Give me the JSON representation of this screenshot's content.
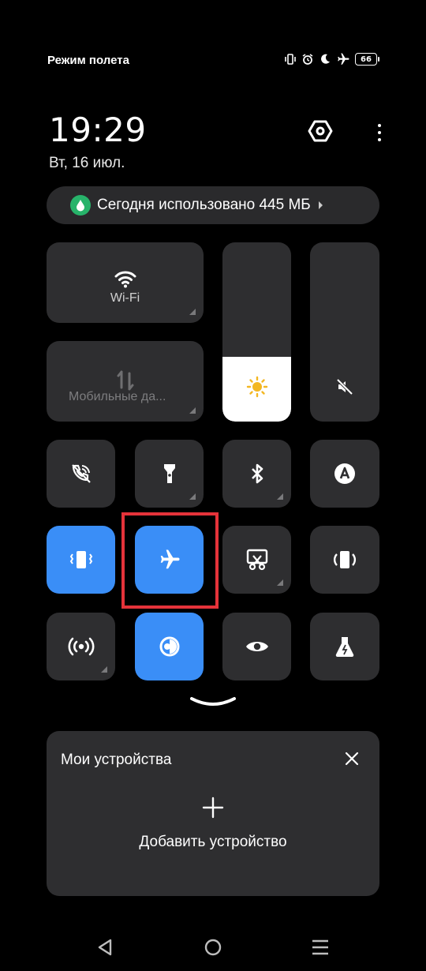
{
  "status_bar": {
    "title": "Режим полета",
    "battery": "66",
    "icons": [
      "vibrate-icon",
      "alarm-icon",
      "moon-icon",
      "airplane-icon",
      "battery-icon"
    ]
  },
  "header": {
    "time": "19:29",
    "date": "Вт, 16 июл.",
    "settings_icon": "hexagon-settings-icon",
    "more_icon": "more-vertical-icon"
  },
  "data_usage": {
    "text": "Сегодня использовано 445 МБ",
    "accent": "#27b36a"
  },
  "big_tiles": {
    "wifi": {
      "label": "Wi-Fi",
      "icon": "wifi-icon",
      "state": "on"
    },
    "mobile_data": {
      "label": "Мобильные да...",
      "icon": "mobile-data-icon",
      "state": "off"
    }
  },
  "sliders": {
    "brightness": {
      "icon": "sun-icon",
      "level": 0.36
    },
    "volume": {
      "icon": "mute-icon",
      "level": 0
    }
  },
  "tiles_row1": [
    {
      "name": "wifi-calling",
      "icon": "wifi-calling-icon",
      "active": false,
      "expandable": false
    },
    {
      "name": "flashlight",
      "icon": "flashlight-icon",
      "active": false,
      "expandable": true
    },
    {
      "name": "bluetooth",
      "icon": "bluetooth-icon",
      "active": false,
      "expandable": true
    },
    {
      "name": "auto-brightness",
      "icon": "auto-a-icon",
      "active": false,
      "expandable": false
    }
  ],
  "tiles_row2": [
    {
      "name": "vibrate",
      "icon": "vibrate-icon",
      "active": true,
      "expandable": false
    },
    {
      "name": "airplane-mode",
      "icon": "airplane-icon",
      "active": true,
      "expandable": false
    },
    {
      "name": "screenshot",
      "icon": "screenshot-scissors-icon",
      "active": false,
      "expandable": true
    },
    {
      "name": "auto-rotate",
      "icon": "rotate-icon",
      "active": false,
      "expandable": false
    }
  ],
  "tiles_row3": [
    {
      "name": "hotspot",
      "icon": "hotspot-icon",
      "active": false,
      "expandable": true
    },
    {
      "name": "dark-mode",
      "icon": "dark-mode-icon",
      "active": true,
      "expandable": false
    },
    {
      "name": "eye-comfort",
      "icon": "eye-icon",
      "active": false,
      "expandable": false
    },
    {
      "name": "lab",
      "icon": "flask-icon",
      "active": false,
      "expandable": false
    }
  ],
  "devices": {
    "title": "Мои устройства",
    "add_label": "Добавить устройство"
  },
  "colors": {
    "accent_blue": "#3a8ef7",
    "tile_bg": "#2e2e30",
    "highlight_red": "#e5333a"
  },
  "nav": [
    "back-icon",
    "home-icon",
    "recents-icon"
  ]
}
